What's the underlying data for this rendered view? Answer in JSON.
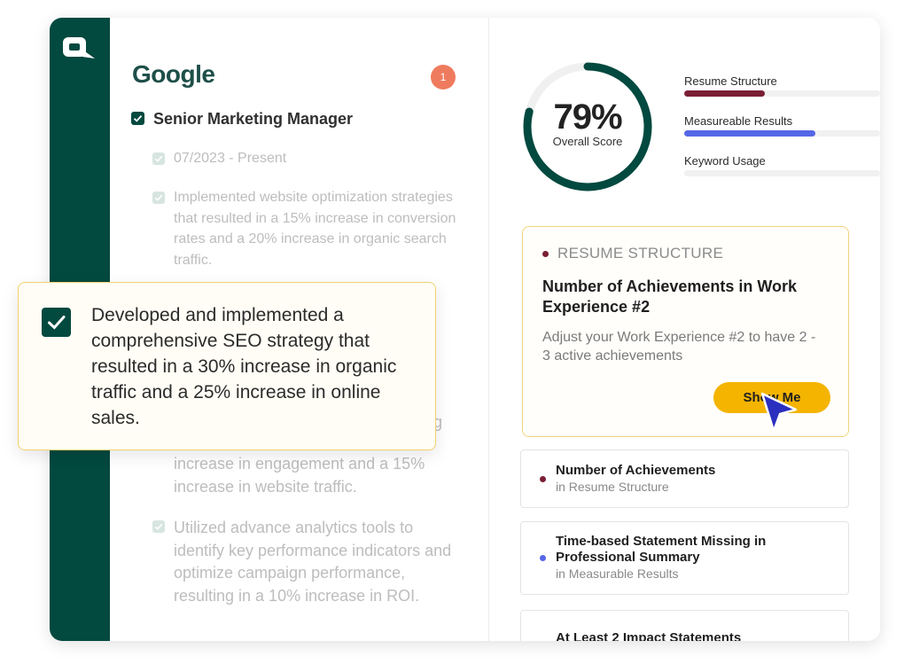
{
  "entry": {
    "company": "Google",
    "notification_count": "1",
    "job_title": "Senior Marketing Manager",
    "date_range": "07/2023 - Present",
    "achievements": [
      "Implemented website optimization strategies that resulted in a 15% increase in conversion rates and a 20% increase in organic search traffic.",
      "increase in engagement and a 15% increase in website traffic.",
      "Utilized advance analytics tools to identify key performance indicators and optimize campaign performance, resulting in a 10% increase in ROI."
    ],
    "partial_fragment": "g"
  },
  "highlight": {
    "text": "Developed and implemented a comprehensive SEO strategy that resulted in a 30% increase in organic traffic and a 25% increase in online sales."
  },
  "score": {
    "value": "79%",
    "label": "Overall Score",
    "fraction": 0.79
  },
  "metrics": [
    {
      "label": "Resume Structure",
      "fraction": 0.41,
      "color": "#7a1e35"
    },
    {
      "label": "Measureable Results",
      "fraction": 0.67,
      "color": "#5566e6"
    },
    {
      "label": "Keyword Usage",
      "fraction": 0.0,
      "color": "#cccccc"
    }
  ],
  "suggestion": {
    "category": "RESUME STRUCTURE",
    "title": "Number of Achievements in Work Experience #2",
    "description": "Adjust your Work Experience #2 to have 2 - 3 active achievements",
    "button": "Show Me"
  },
  "issues": [
    {
      "title": "Number of Achievements",
      "subtitle": "in Resume Structure",
      "color": "#7a1e35"
    },
    {
      "title": "Time-based Statement Missing in Professional Summary",
      "subtitle": "in Measurable Results",
      "color": "#5566e6"
    },
    {
      "title": "At Least 2 Impact Statements",
      "subtitle": "",
      "color": "#7a1e35"
    }
  ],
  "colors": {
    "brand": "#02493f",
    "accent": "#f4b400",
    "badge": "#ef7b5e"
  },
  "icons": [
    "logo-icon",
    "checkbox-icon",
    "cursor-icon"
  ]
}
